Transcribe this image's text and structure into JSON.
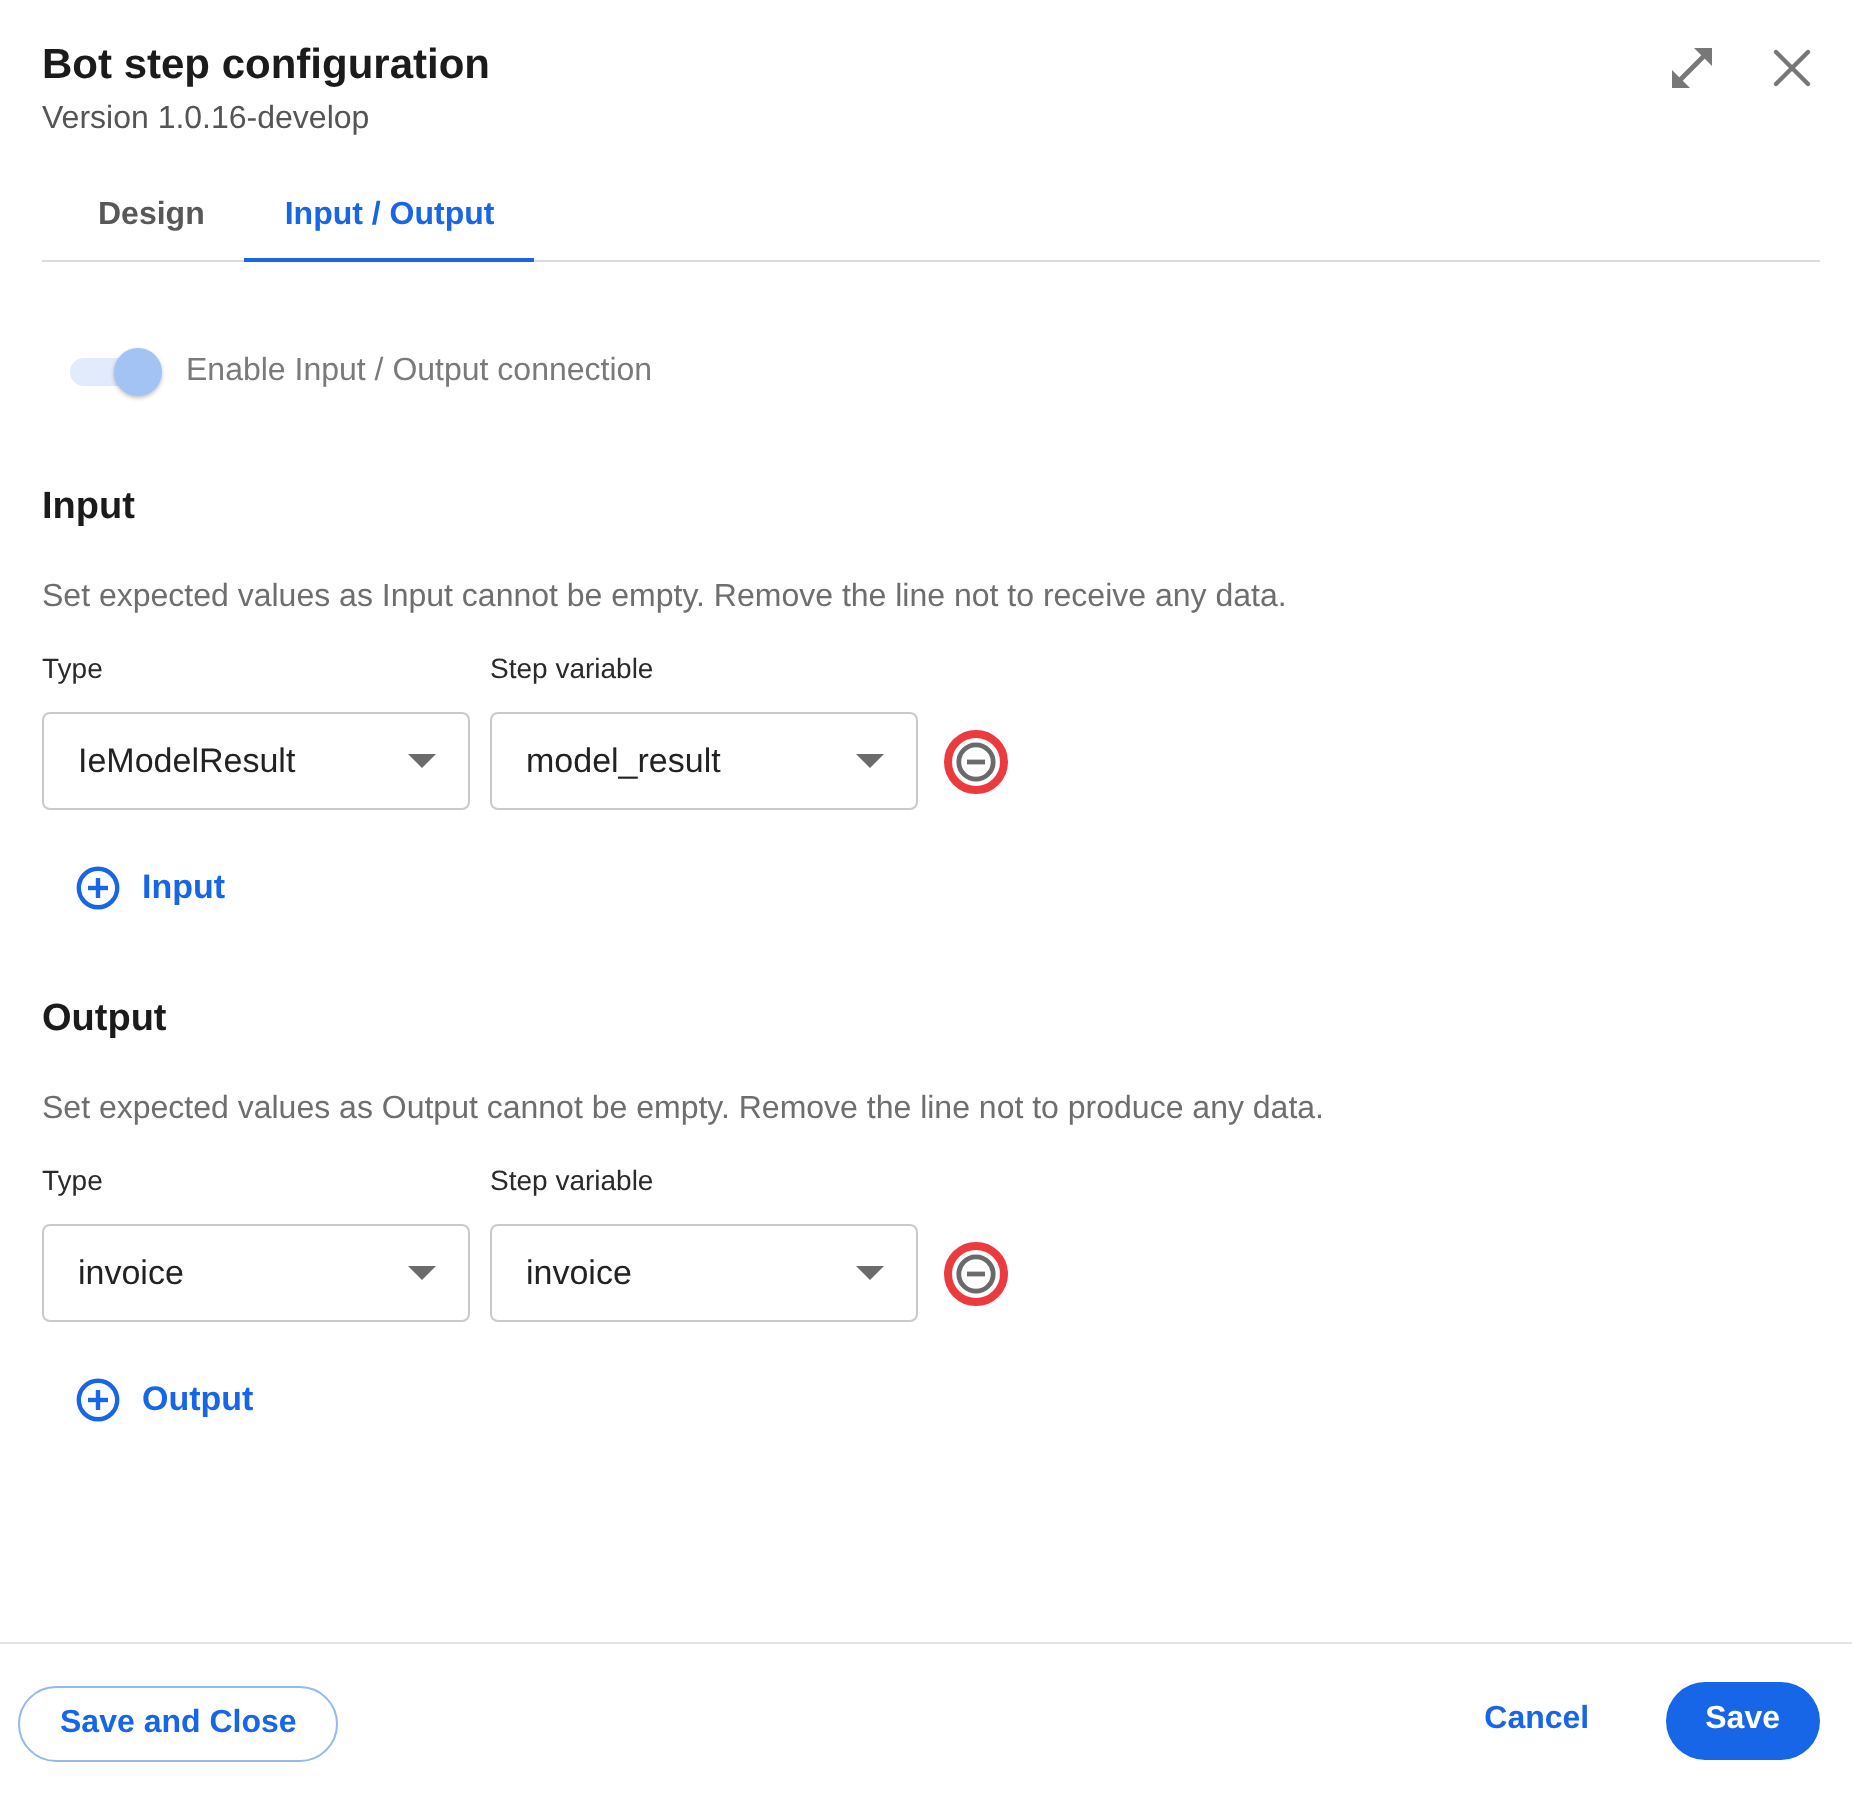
{
  "dialog": {
    "title": "Bot step configuration",
    "subtitle": "Version 1.0.16-develop"
  },
  "tabs": [
    {
      "label": "Design",
      "selected": false
    },
    {
      "label": "Input / Output",
      "selected": true
    }
  ],
  "connection_toggle": {
    "label": "Enable Input / Output connection",
    "on": true,
    "disabled": true
  },
  "sections": [
    {
      "title": "Input",
      "description": "Set expected values as Input cannot be empty. Remove the line not to receive any data.",
      "type_label": "Type",
      "variable_label": "Step variable",
      "rows": [
        {
          "type": "IeModelResult",
          "variable": "model_result"
        }
      ],
      "add_label": "Input"
    },
    {
      "title": "Output",
      "description": "Set expected values as Output cannot be empty. Remove the line not to produce any data.",
      "type_label": "Type",
      "variable_label": "Step variable",
      "rows": [
        {
          "type": "invoice",
          "variable": "invoice"
        }
      ],
      "add_label": "Output"
    }
  ],
  "footer": {
    "buttons": [
      {
        "label": "Save and Close",
        "kind": "outlined"
      },
      {
        "label": "Cancel",
        "kind": "text"
      },
      {
        "label": "Save",
        "kind": "filled"
      }
    ]
  }
}
